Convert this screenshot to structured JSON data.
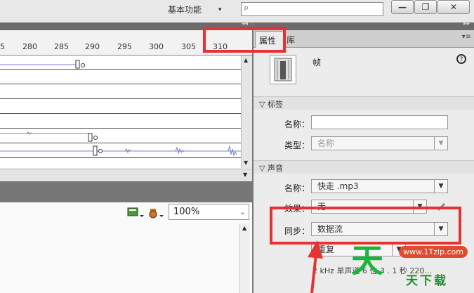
{
  "topbar": {
    "workspace_label": "基本功能",
    "workspace_caret": "▾",
    "search_icon_glyph": "⌕",
    "minimize": "—",
    "restore": "❐",
    "close": "✕"
  },
  "timeline": {
    "panel_arrows": "◂◂",
    "ruler_ticks": [
      "5",
      "280",
      "285",
      "290",
      "295",
      "300",
      "305",
      "310"
    ],
    "scroll_up": "▲",
    "scroll_down": "▼",
    "zoom_value": "100%",
    "zoom_caret": "⌄"
  },
  "properties": {
    "panel_arrows": "▸▸",
    "tab_active": "属性",
    "tab_inactive": "库",
    "menu_glyph": "▾≡",
    "element_type": "帧",
    "help_glyph": "?",
    "label_section": {
      "title": "标签",
      "name_label": "名称：",
      "name_value": "",
      "type_label": "类型：",
      "type_value": "名称"
    },
    "sound_section": {
      "title": "声音",
      "name_label": "名称：",
      "name_value": "快走 .mp3",
      "effect_label": "效果：",
      "effect_value": "无",
      "sync_label": "同步：",
      "sync_value": "数据流",
      "repeat_value": "重复",
      "info_text": "2 kHz 单声道 6 位 3 . 1 秒 220..."
    }
  },
  "watermark": {
    "glyph": "天",
    "brand": "天下载",
    "url": "www.1Tzip.com"
  },
  "colors": {
    "highlight_red": "#e63232",
    "watermark_green": "#18b63a",
    "waveform": "#7b7fd6"
  }
}
